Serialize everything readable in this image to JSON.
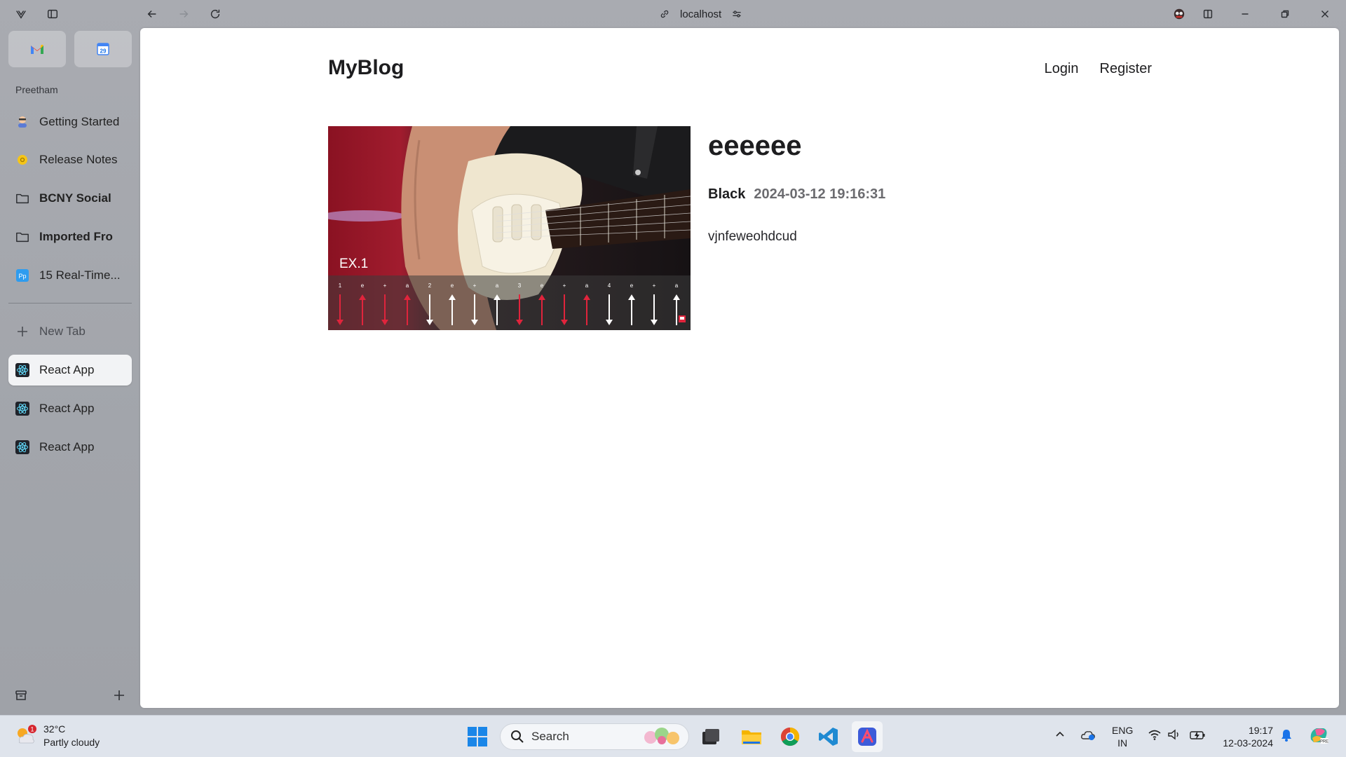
{
  "browser": {
    "url": "localhost",
    "colors": {
      "chrome": "#a9abb1",
      "active_tab_bg": "#f2f3f5"
    }
  },
  "sidebar": {
    "space_name": "Preetham",
    "pinned": [
      {
        "icon": "gmail-icon"
      },
      {
        "icon": "calendar-icon",
        "badge": "29"
      }
    ],
    "items": [
      {
        "label": "Getting Started",
        "icon": "arc-avatar-icon"
      },
      {
        "label": "Release Notes",
        "icon": "release-notes-icon"
      },
      {
        "label": "BCNY Social",
        "icon": "folder-icon"
      },
      {
        "label": "Imported Fro",
        "icon": "folder-icon"
      },
      {
        "label": "15 Real-Time...",
        "icon": "pp-icon",
        "icon_text": "Pp"
      }
    ],
    "new_tab_label": "New Tab",
    "tabs": [
      {
        "label": "React App",
        "icon": "react-icon",
        "active": true
      },
      {
        "label": "React App",
        "icon": "react-icon",
        "active": false
      },
      {
        "label": "React App",
        "icon": "react-icon",
        "active": false
      }
    ]
  },
  "site": {
    "logo": "MyBlog",
    "nav": {
      "login": "Login",
      "register": "Register"
    }
  },
  "post": {
    "image_caption": "EX.1",
    "strum_counts": [
      "1",
      "e",
      "+",
      "a",
      "2",
      "e",
      "+",
      "a",
      "3",
      "e",
      "+",
      "a",
      "4",
      "e",
      "+",
      "a"
    ],
    "title": "eeeeee",
    "author": "Black",
    "date": "2024-03-12 19:16:31",
    "body": "vjnfeweohdcud"
  },
  "taskbar": {
    "weather": {
      "badge": "1",
      "temp": "32°C",
      "condition": "Partly cloudy"
    },
    "search_placeholder": "Search",
    "lang_line1": "ENG",
    "lang_line2": "IN",
    "time": "19:17",
    "date": "12-03-2024"
  }
}
